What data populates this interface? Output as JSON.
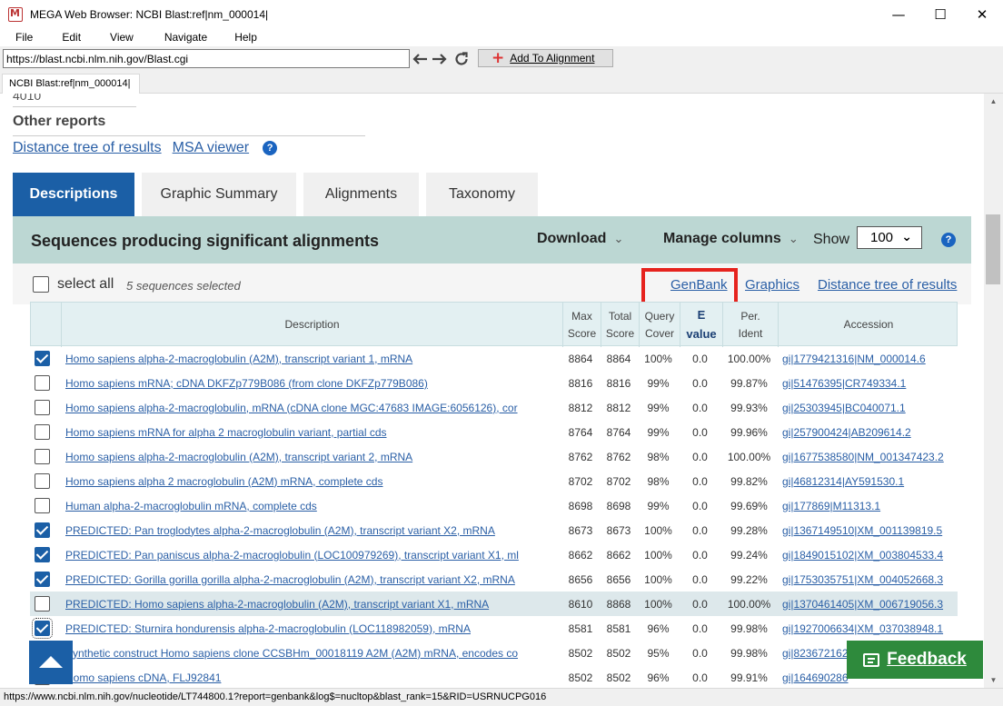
{
  "window": {
    "title": "MEGA Web Browser: NCBI Blast:ref|nm_000014|",
    "minimize": "—",
    "maximize": "☐",
    "close": "✕"
  },
  "menu": [
    "File",
    "Edit",
    "View",
    "Navigate",
    "Help"
  ],
  "toolbar": {
    "url": "https://blast.ncbi.nlm.nih.gov/Blast.cgi",
    "back_icon": "arrow-left-icon",
    "forward_icon": "arrow-right-icon",
    "refresh_icon": "refresh-icon",
    "add_to_alignment": "Add To Alignment"
  },
  "tab": {
    "label": "NCBI Blast:ref|nm_000014|"
  },
  "page": {
    "cut_off_text": "4010",
    "other_reports": "Other reports",
    "report_links": [
      "Distance tree of results",
      "MSA viewer"
    ],
    "help_glyph": "?"
  },
  "result_tabs": [
    "Descriptions",
    "Graphic Summary",
    "Alignments",
    "Taxonomy"
  ],
  "panel": {
    "title": "Sequences producing significant alignments",
    "download": "Download",
    "manage_columns": "Manage columns",
    "show_label": "Show",
    "show_value": "100",
    "chevron": "⌄",
    "caret": "⌄"
  },
  "selection": {
    "select_all": "select all",
    "count": "5 sequences selected",
    "links": [
      "GenBank",
      "Graphics",
      "Distance tree of results"
    ]
  },
  "table": {
    "headers": {
      "description": "Description",
      "max_score": [
        "Max",
        "Score"
      ],
      "total_score": [
        "Total",
        "Score"
      ],
      "query_cover": [
        "Query",
        "Cover"
      ],
      "e_value": [
        "E",
        "value"
      ],
      "per_ident": [
        "Per.",
        "Ident"
      ],
      "accession": "Accession"
    },
    "rows": [
      {
        "checked": true,
        "description": "Homo sapiens alpha-2-macroglobulin (A2M), transcript variant 1, mRNA",
        "max": "8864",
        "total": "8864",
        "cover": "100%",
        "e": "0.0",
        "ident": "100.00%",
        "accession": "gi|1779421316|NM_000014.6"
      },
      {
        "checked": false,
        "description": "Homo sapiens mRNA; cDNA DKFZp779B086 (from clone DKFZp779B086)",
        "max": "8816",
        "total": "8816",
        "cover": "99%",
        "e": "0.0",
        "ident": "99.87%",
        "accession": "gi|51476395|CR749334.1"
      },
      {
        "checked": false,
        "description": "Homo sapiens alpha-2-macroglobulin, mRNA (cDNA clone MGC:47683 IMAGE:6056126), cor",
        "max": "8812",
        "total": "8812",
        "cover": "99%",
        "e": "0.0",
        "ident": "99.93%",
        "accession": "gi|25303945|BC040071.1"
      },
      {
        "checked": false,
        "description": "Homo sapiens mRNA for alpha 2 macroglobulin variant, partial cds",
        "max": "8764",
        "total": "8764",
        "cover": "99%",
        "e": "0.0",
        "ident": "99.96%",
        "accession": "gi|257900424|AB209614.2"
      },
      {
        "checked": false,
        "description": "Homo sapiens alpha-2-macroglobulin (A2M), transcript variant 2, mRNA",
        "max": "8762",
        "total": "8762",
        "cover": "98%",
        "e": "0.0",
        "ident": "100.00%",
        "accession": "gi|1677538580|NM_001347423.2"
      },
      {
        "checked": false,
        "description": "Homo sapiens alpha 2 macroglobulin (A2M) mRNA, complete cds",
        "max": "8702",
        "total": "8702",
        "cover": "98%",
        "e": "0.0",
        "ident": "99.82%",
        "accession": "gi|46812314|AY591530.1"
      },
      {
        "checked": false,
        "description": "Human alpha-2-macroglobulin mRNA, complete cds",
        "max": "8698",
        "total": "8698",
        "cover": "99%",
        "e": "0.0",
        "ident": "99.69%",
        "accession": "gi|177869|M11313.1"
      },
      {
        "checked": true,
        "description": "PREDICTED: Pan troglodytes alpha-2-macroglobulin (A2M), transcript variant X2, mRNA",
        "max": "8673",
        "total": "8673",
        "cover": "100%",
        "e": "0.0",
        "ident": "99.28%",
        "accession": "gi|1367149510|XM_001139819.5"
      },
      {
        "checked": true,
        "description": "PREDICTED: Pan paniscus alpha-2-macroglobulin (LOC100979269), transcript variant X1, ml",
        "max": "8662",
        "total": "8662",
        "cover": "100%",
        "e": "0.0",
        "ident": "99.24%",
        "accession": "gi|1849015102|XM_003804533.4"
      },
      {
        "checked": true,
        "description": "PREDICTED: Gorilla gorilla gorilla alpha-2-macroglobulin (A2M), transcript variant X2, mRNA",
        "max": "8656",
        "total": "8656",
        "cover": "100%",
        "e": "0.0",
        "ident": "99.22%",
        "accession": "gi|1753035751|XM_004052668.3"
      },
      {
        "checked": false,
        "highlight": true,
        "description": "PREDICTED: Homo sapiens alpha-2-macroglobulin (A2M), transcript variant X1, mRNA",
        "max": "8610",
        "total": "8868",
        "cover": "100%",
        "e": "0.0",
        "ident": "100.00%",
        "accession": "gi|1370461405|XM_006719056.3"
      },
      {
        "checked": true,
        "focus": true,
        "description": "PREDICTED: Sturnira hondurensis alpha-2-macroglobulin (LOC118982059), mRNA",
        "max": "8581",
        "total": "8581",
        "cover": "96%",
        "e": "0.0",
        "ident": "99.98%",
        "accession": "gi|1927006634|XM_037038948.1"
      },
      {
        "checked": false,
        "description": "Synthetic construct Homo sapiens clone CCSBHm_00018119 A2M (A2M) mRNA, encodes co",
        "max": "8502",
        "total": "8502",
        "cover": "95%",
        "e": "0.0",
        "ident": "99.98%",
        "accession": "gi|823672162"
      },
      {
        "checked": false,
        "description": "Homo sapiens cDNA, FLJ92841",
        "max": "8502",
        "total": "8502",
        "cover": "96%",
        "e": "0.0",
        "ident": "99.91%",
        "accession": "gi|164690286"
      }
    ]
  },
  "feedback": "Feedback",
  "status": "https://www.ncbi.nlm.nih.gov/nucleotide/LT744800.1?report=genbank&log$=nucltop&blast_rank=15&RID=USRNUCPG016"
}
